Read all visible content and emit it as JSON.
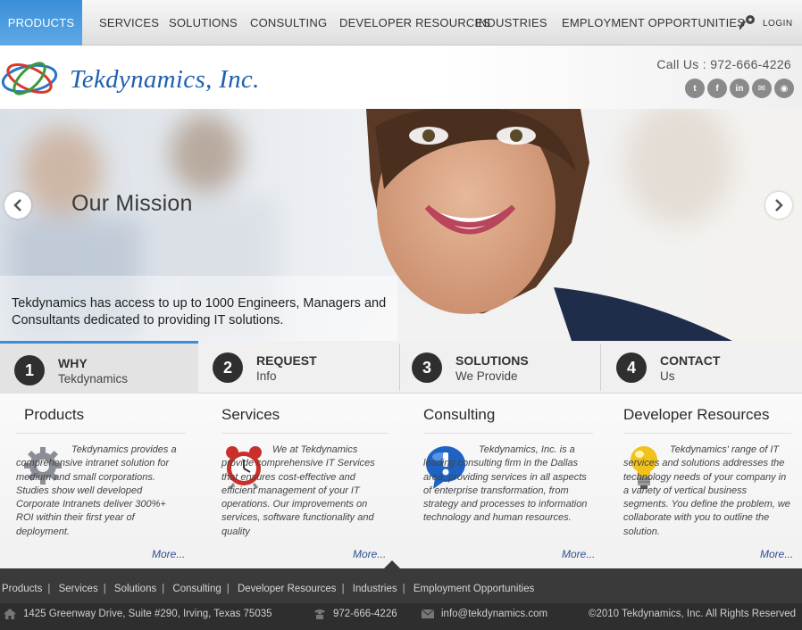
{
  "nav": {
    "items": [
      {
        "label": "PRODUCTS",
        "active": true
      },
      {
        "label": "SERVICES",
        "active": false
      },
      {
        "label": "SOLUTIONS",
        "active": false
      },
      {
        "label": "CONSULTING",
        "active": false
      },
      {
        "label": "DEVELOPER RESOURCES",
        "active": false
      },
      {
        "label": "INDUSTRIES",
        "active": false
      },
      {
        "label": "EMPLOYMENT OPPORTUNITIES",
        "active": false
      }
    ],
    "login_label": "LOGIN",
    "login_icon": "key-icon"
  },
  "header": {
    "company_name": "Tekdynamics, Inc.",
    "call_label": "Call Us :",
    "phone": "972-666-4226",
    "social": [
      {
        "name": "twitter-icon",
        "glyph": "t"
      },
      {
        "name": "facebook-icon",
        "glyph": "f"
      },
      {
        "name": "linkedin-icon",
        "glyph": "in"
      },
      {
        "name": "email-icon",
        "glyph": "✉"
      },
      {
        "name": "rss-icon",
        "glyph": "◉"
      }
    ]
  },
  "hero": {
    "title": "Our Mission",
    "caption": "Tekdynamics has access to up to 1000 Engineers, Managers and Consultants dedicated to providing IT solutions."
  },
  "steps": [
    {
      "num": "1",
      "title": "WHY",
      "subtitle": "Tekdynamics",
      "active": true
    },
    {
      "num": "2",
      "title": "REQUEST",
      "subtitle": "Info",
      "active": false
    },
    {
      "num": "3",
      "title": "SOLUTIONS",
      "subtitle": "We Provide",
      "active": false
    },
    {
      "num": "4",
      "title": "CONTACT",
      "subtitle": "Us",
      "active": false
    }
  ],
  "columns": [
    {
      "title": "Products",
      "icon": "gear-icon",
      "text": "Tekdynamics provides a comprehensive intranet solution for medium and small corporations. Studies show well developed Corporate Intranets deliver 300%+ ROI within their first year of deployment.",
      "more": "More..."
    },
    {
      "title": "Services",
      "icon": "alarm-clock-icon",
      "text": "We at Tekdynamics provide comprehensive IT Services that ensures cost-effective and efficient management of your IT operations. Our improvements on services, software functionality and quality",
      "more": "More..."
    },
    {
      "title": "Consulting",
      "icon": "info-bubble-icon",
      "text": "Tekdynamics, Inc. is a leading consulting firm in the Dallas area, providing services in all aspects of enterprise transformation, from strategy and processes to information technology and human resources.",
      "more": "More..."
    },
    {
      "title": "Developer Resources",
      "icon": "lightbulb-icon",
      "text": "Tekdynamics' range of IT services and solutions addresses the technology needs of your company in a variety of vertical business segments. You define the problem, we collaborate with you to outline the solution.",
      "more": "More..."
    }
  ],
  "footer": {
    "links": [
      "Products",
      "Services",
      "Solutions",
      "Consulting",
      "Developer Resources",
      "Industries",
      "Employment Opportunities"
    ],
    "address": "1425 Greenway Drive, Suite #290, Irving, Texas 75035",
    "phone": "972-666-4226",
    "email": "info@tekdynamics.com",
    "copyright": "©2010 Tekdynamics, Inc. All Rights Reserved"
  },
  "colors": {
    "accent": "#3a8fd8",
    "brand": "#1f5fb0",
    "footer": "#3a3a3a"
  }
}
